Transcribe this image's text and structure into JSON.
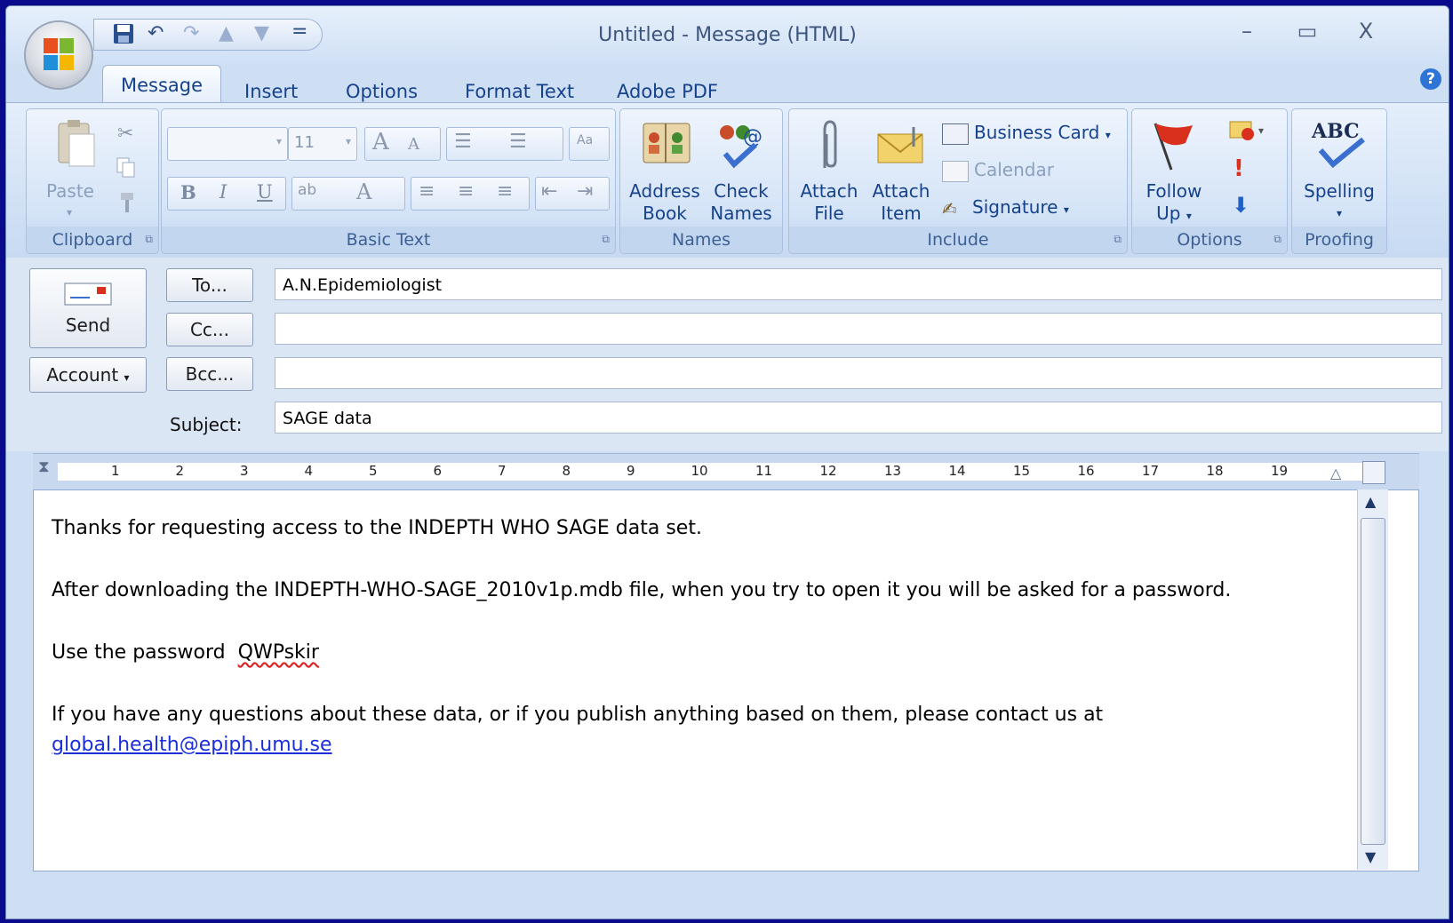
{
  "window": {
    "title": "Untitled - Message (HTML)"
  },
  "window_controls": {
    "minimize": "–",
    "maximize": "▭",
    "close": "X"
  },
  "qat": {
    "customize": "="
  },
  "tabs": [
    "Message",
    "Insert",
    "Options",
    "Format Text",
    "Adobe PDF"
  ],
  "help": "?",
  "ribbon": {
    "clipboard": {
      "paste": "Paste",
      "label": "Clipboard"
    },
    "basic_text": {
      "font_size": "11",
      "bold": "B",
      "italic": "I",
      "underline": "U",
      "grow": "A",
      "shrink": "A",
      "label": "Basic Text"
    },
    "names": {
      "address_book": [
        "Address",
        "Book"
      ],
      "check_names": [
        "Check",
        "Names"
      ],
      "label": "Names"
    },
    "include": {
      "attach_file": [
        "Attach",
        "File"
      ],
      "attach_item": [
        "Attach",
        "Item"
      ],
      "business_card": "Business Card",
      "calendar": "Calendar",
      "signature": "Signature",
      "label": "Include"
    },
    "options": {
      "follow_up": [
        "Follow",
        "Up"
      ],
      "label": "Options"
    },
    "proofing": {
      "spelling": "Spelling",
      "abc": "ABC",
      "label": "Proofing"
    }
  },
  "header": {
    "send": "Send",
    "account": "Account",
    "to_button": "To...",
    "cc_button": "Cc...",
    "bcc_button": "Bcc...",
    "subject_label": "Subject:",
    "to_value": "A.N.Epidemiologist",
    "cc_value": "",
    "bcc_value": "",
    "subject_value": "SAGE data"
  },
  "ruler_numbers": [
    "1",
    "2",
    "3",
    "4",
    "5",
    "6",
    "7",
    "8",
    "9",
    "10",
    "11",
    "12",
    "13",
    "14",
    "15",
    "16",
    "17",
    "18",
    "19"
  ],
  "body": {
    "p1": "Thanks for requesting access to the INDEPTH WHO SAGE data set.",
    "p2": "After downloading the INDEPTH-WHO-SAGE_2010v1p.mdb file, when you try to open it you will be asked for a password.",
    "p3_prefix": "Use the password  ",
    "p3_password": "QWPskir",
    "p4": "If you have any questions about these data, or if you publish anything based on them, please contact us at",
    "email": "global.health@epiph.umu.se"
  }
}
